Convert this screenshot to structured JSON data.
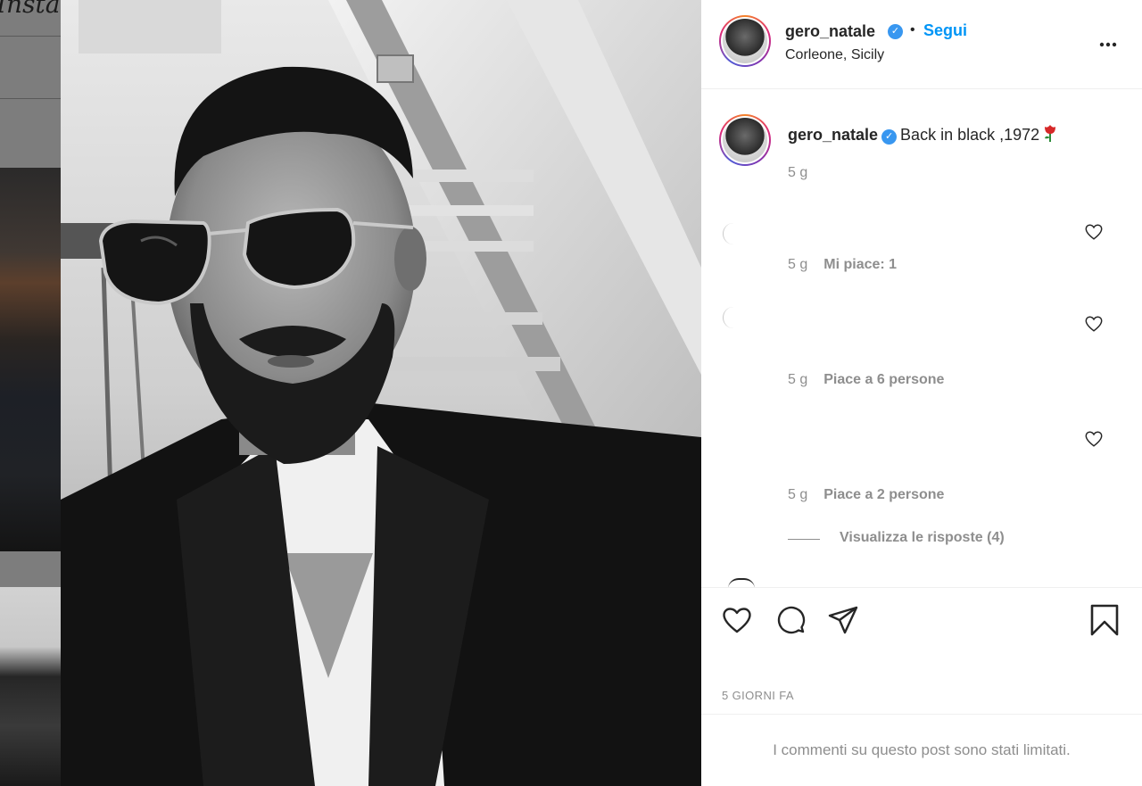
{
  "background": {
    "logo_fragment": "Insta"
  },
  "post": {
    "username": "gero_natale",
    "verified": true,
    "separator": "•",
    "follow_label": "Segui",
    "location": "Corleone, Sicily",
    "more_icon": "more-horizontal-icon",
    "caption": {
      "username": "gero_natale",
      "text": "Back in black ,1972",
      "emoji_icon": "rose-icon",
      "time": "5 g"
    },
    "comments": [
      {
        "time": "5 g",
        "likes": "Mi piace: 1"
      },
      {
        "time": "5 g",
        "likes": "Piace a 6 persone"
      },
      {
        "time": "5 g",
        "likes": "Piace a 2 persone",
        "replies_label": "Visualizza le risposte (4)"
      }
    ],
    "actions": {
      "like_icon": "heart-icon",
      "comment_icon": "comment-icon",
      "share_icon": "share-icon",
      "save_icon": "bookmark-icon"
    },
    "date": "5 GIORNI FA",
    "comments_limited": "I commenti su questo post sono stati limitati."
  },
  "colors": {
    "accent_blue": "#0095f6",
    "verified_blue": "#3897f0",
    "muted_text": "#8e8e8e",
    "text": "#262626"
  }
}
